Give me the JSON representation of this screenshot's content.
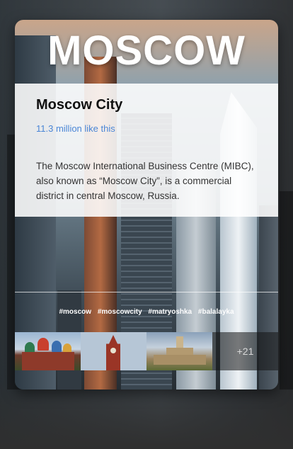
{
  "city": {
    "title": "MOSCOW"
  },
  "info": {
    "name": "Moscow City",
    "likes": "11.3 million like this",
    "description": "The Moscow International Business Centre (MIBC), also known as “Moscow City”, is a commercial district in central Moscow, Russia."
  },
  "tags": [
    "#moscow",
    "#moscowcity",
    "#matryoshka",
    "#balalayka"
  ],
  "gallery": {
    "thumbnails": [
      "st-basils-cathedral",
      "kremlin-spasskaya-tower",
      "moscow-state-university"
    ],
    "more_label": "+21"
  },
  "colors": {
    "accent_link": "#4a86d6",
    "page_background": "#2f2f2f",
    "panel_background": "#ffffff"
  }
}
